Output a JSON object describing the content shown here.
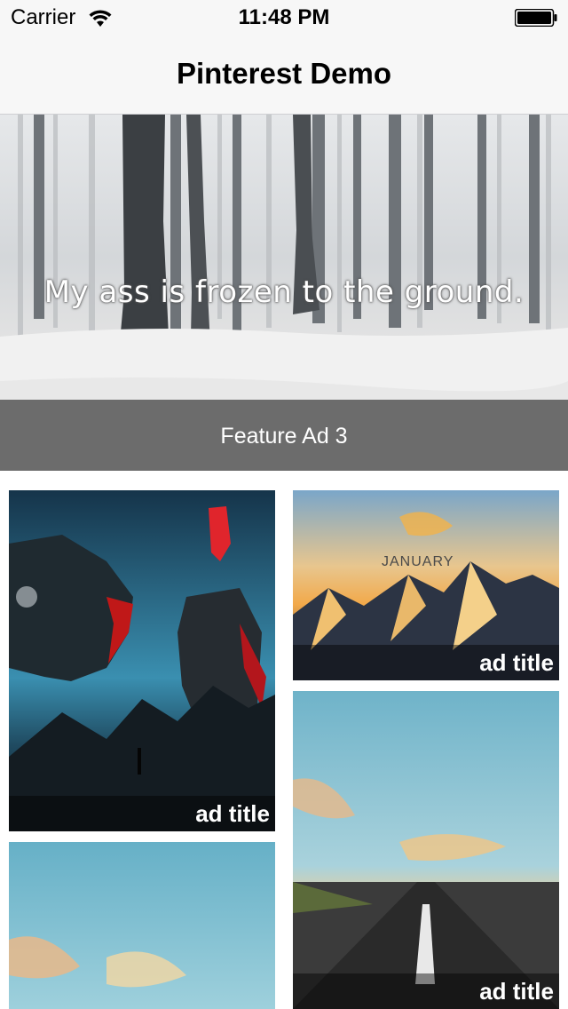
{
  "status_bar": {
    "carrier": "Carrier",
    "time": "11:48 PM"
  },
  "nav": {
    "title": "Pinterest Demo"
  },
  "feature": {
    "caption": "My ass is frozen to the ground.",
    "label": "Feature Ad 3"
  },
  "tiles": [
    {
      "title": "ad title",
      "image": "dragon-knight-illustration"
    },
    {
      "title": "ad title",
      "image": "january-mountains",
      "image_text": "JANUARY"
    },
    {
      "title": "ad title",
      "image": "road-sky"
    },
    {
      "title": "",
      "image": "sky-clouds"
    }
  ]
}
